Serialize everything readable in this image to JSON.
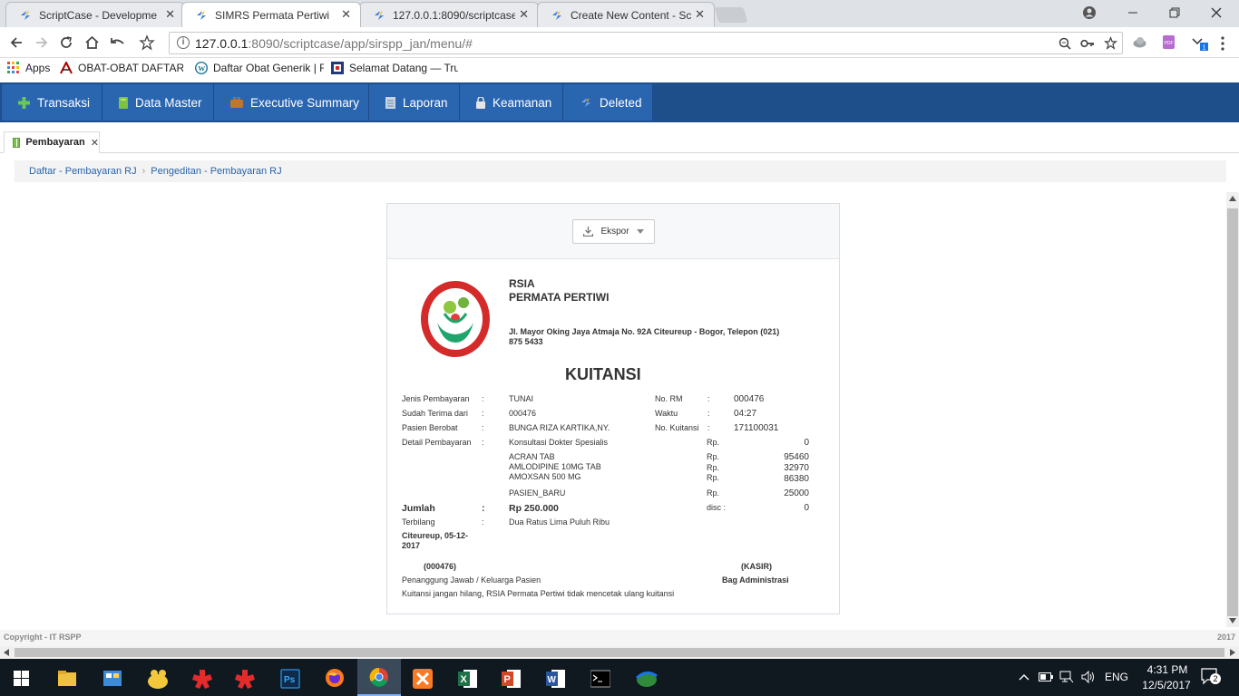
{
  "browser": {
    "tabs": [
      {
        "title": "ScriptCase - Developme",
        "active": false
      },
      {
        "title": "SIMRS Permata Pertiwi",
        "active": true
      },
      {
        "title": "127.0.0.1:8090/scriptcase",
        "active": false
      },
      {
        "title": "Create New Content - Sc",
        "active": false
      }
    ],
    "close_glyph": "✕",
    "url_host": "127.0.0.1",
    "url_rest": ":8090/scriptcase/app/sirspp_jan/menu/#",
    "bookmarks": [
      {
        "label": "Apps",
        "icon": "apps-grid-icon"
      },
      {
        "label": "OBAT-OBAT DAFTAR G",
        "icon": "pharmacy-icon"
      },
      {
        "label": "Daftar Obat Generik | F",
        "icon": "wordpress-icon"
      },
      {
        "label": "Selamat Datang — Tru",
        "icon": "site-icon"
      }
    ]
  },
  "app_menu": {
    "items": [
      {
        "label": "Transaksi",
        "color": "#5cb85c"
      },
      {
        "label": "Data Master",
        "color": "#7dc242"
      },
      {
        "label": "Executive Summary",
        "color": "#b97a2c"
      },
      {
        "label": "Laporan",
        "color": "#8aa4c8"
      },
      {
        "label": "Keamanan",
        "color": "#e6e6e6"
      },
      {
        "label": "Deleted",
        "color": "#7fa7e0"
      }
    ]
  },
  "app_tab": {
    "label": "Pembayaran",
    "close": "✕"
  },
  "breadcrumb": {
    "first": "Daftar - Pembayaran RJ",
    "separator": "›",
    "second": "Pengeditan - Pembayaran RJ"
  },
  "export": {
    "label": "Ekspor"
  },
  "receipt": {
    "org_line1": "RSIA",
    "org_line2": "PERMATA PERTIWI",
    "address_line1": "Jl. Mayor Oking Jaya Atmaja No. 92A Citeureup - Bogor, Telepon (021)",
    "address_line2": "875 5433",
    "title": "KUITANSI",
    "colon": ":",
    "fields": {
      "jenis_label": "Jenis Pembayaran",
      "jenis_value": "TUNAI",
      "terima_label": "Sudah Terima dari",
      "terima_value": "000476",
      "pasien_label": "Pasien Berobat",
      "pasien_value": "BUNGA RIZA KARTIKA,NY.",
      "detail_label": "Detail Pembayaran",
      "rm_label": "No. RM",
      "rm_value": "000476",
      "waktu_label": "Waktu",
      "waktu_value": "04:27",
      "kuitansi_label": "No. Kuitansi",
      "kuitansi_value": "171100031"
    },
    "details": [
      {
        "name": "Konsultasi Dokter Spesialis",
        "currency": "Rp.",
        "amount": "0"
      },
      {
        "name": "ACRAN TAB",
        "currency": "Rp.",
        "amount": "95460"
      },
      {
        "name": "AMLODIPINE 10MG TAB",
        "currency": "Rp.",
        "amount": "32970"
      },
      {
        "name": "AMOXSAN 500 MG",
        "currency": "Rp.",
        "amount": "86380"
      },
      {
        "name": "PASIEN_BARU",
        "currency": "Rp.",
        "amount": "25000"
      }
    ],
    "jumlah_label": "Jumlah",
    "jumlah_value": "Rp 250.000",
    "disc_label": "disc :",
    "disc_value": "0",
    "terbilang_label": "Terbilang",
    "terbilang_value": "Dua Ratus Lima Puluh Ribu",
    "place_date_line1": "Citeureup, 05-12-",
    "place_date_line2": "2017",
    "signer_left_name": "(000476)",
    "signer_left_role": "Penanggung Jawab / Keluarga Pasien",
    "signer_right_name": "(KASIR)",
    "signer_right_role": "Bag Administrasi",
    "note": "Kuitansi jangan hilang, RSIA Permata Pertiwi tidak mencetak ulang kuitansi"
  },
  "footer": {
    "left": "Copyright - IT RSPP",
    "right": "2017"
  },
  "taskbar": {
    "language": "ENG",
    "time": "4:31 PM",
    "date": "12/5/2017",
    "notifications": "2"
  }
}
